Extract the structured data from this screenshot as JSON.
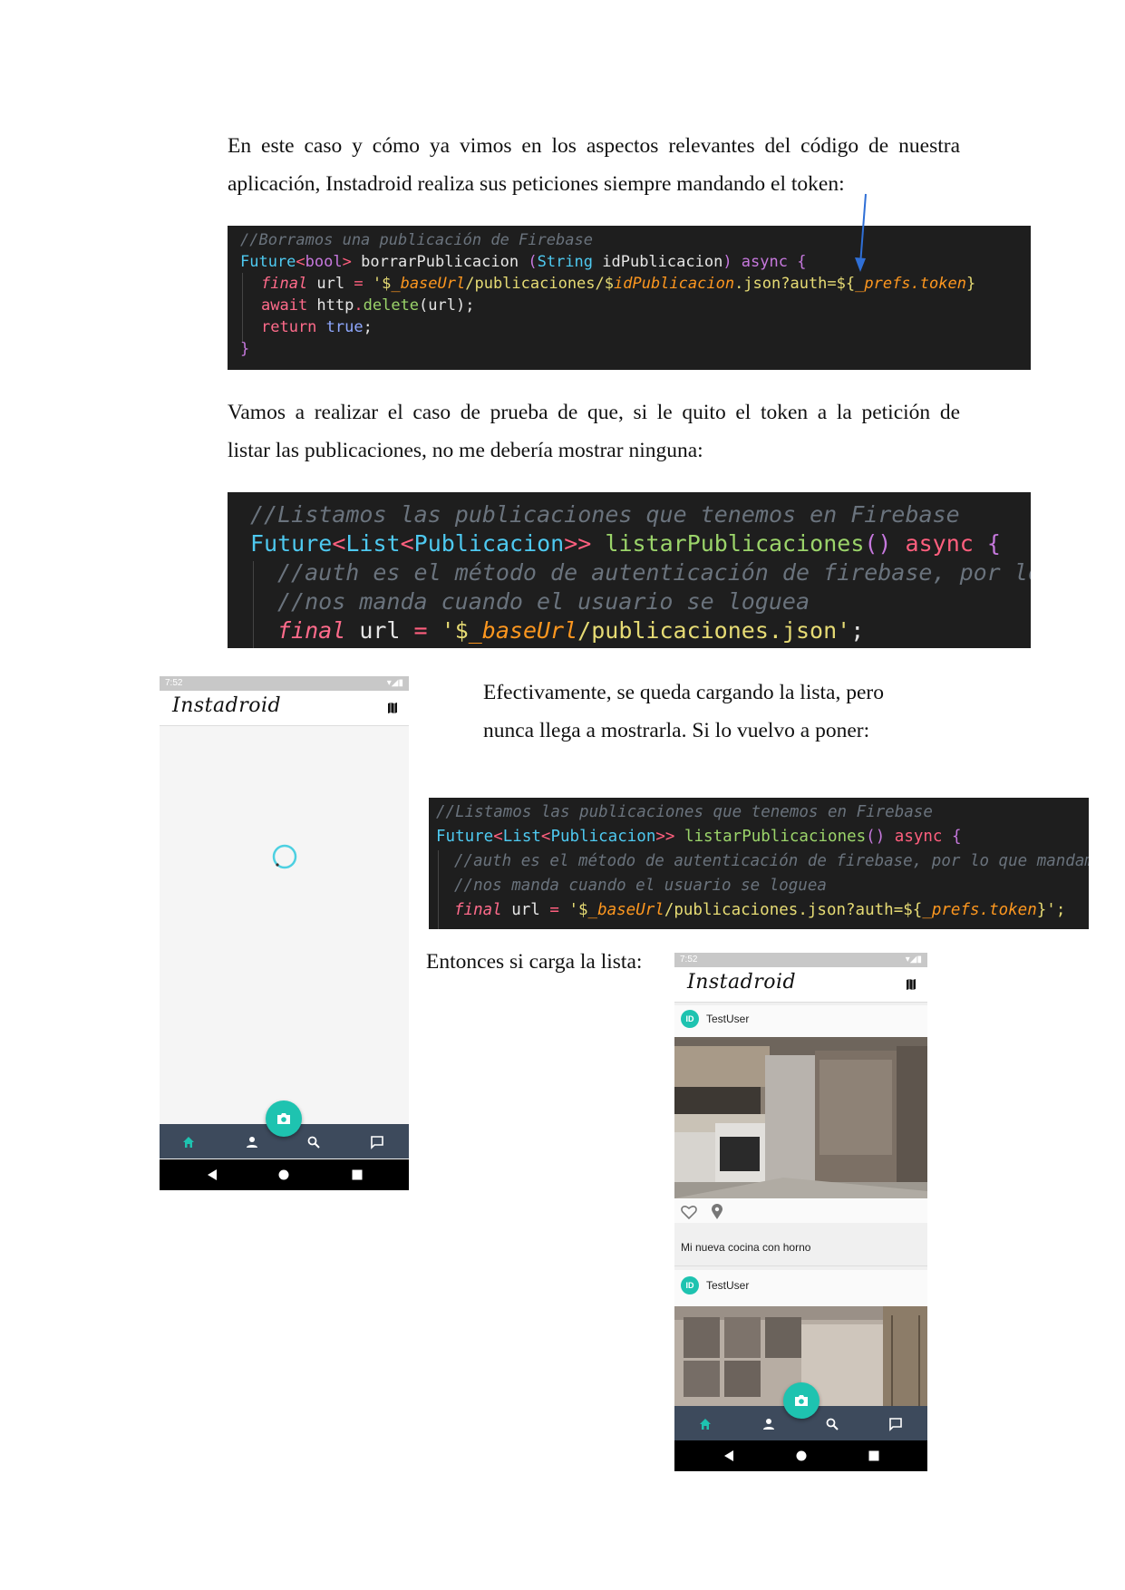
{
  "paragraph1": {
    "line1": "En este caso y cómo ya vimos en los aspectos relevantes del código de nuestra",
    "line2": "aplicación, Instadroid realiza sus peticiones siempre mandando el token:"
  },
  "code1": {
    "comment": "//Borramos una publicación de Firebase",
    "l2_type": "Future",
    "l2_lt": "<",
    "l2_bool": "bool",
    "l2_gt": ">",
    "l2_fn": " borrarPublicacion ",
    "l2_paren": "(",
    "l2_string": "String",
    "l2_param": " idPublicacion",
    "l2_close": ") ",
    "l2_async": "async",
    "l2_brace": " {",
    "l3_final": "final",
    "l3_url": " url ",
    "l3_eq": "=",
    "l3_q": " '$",
    "l3_base": "_baseUrl",
    "l3_path": "/publicaciones/$",
    "l3_id": "idPublicacion",
    "l3_json": ".json?auth=${",
    "l3_prefs": "_prefs.token",
    "l3_end": "}",
    "l4_await": "await",
    "l4_http": " http",
    "l4_dot": ".",
    "l4_delete": "delete",
    "l4_args": "(url);",
    "l5_return": "return",
    "l5_true": " true",
    "l5_semi": ";",
    "l6_brace": "}"
  },
  "paragraph2": {
    "line1": "Vamos a realizar el caso de prueba de que, si le quito el token a la petición de",
    "line2": "listar las publicaciones, no me debería mostrar ninguna:"
  },
  "code2": {
    "comment1": "//Listamos las publicaciones que tenemos en Firebase",
    "l2_future": "Future",
    "l2_lt1": "<",
    "l2_list": "List",
    "l2_lt2": "<",
    "l2_pub": "Publicacion",
    "l2_gt": ">>",
    "l2_fn": " listarPublicaciones",
    "l2_parens": "()",
    "l2_async": " async",
    "l2_brace": " {",
    "comment2": "//auth es el método de autenticación de firebase, por lo",
    "comment3": "//nos manda cuando el usuario se loguea",
    "l5_final": "final",
    "l5_url": " url ",
    "l5_eq": "=",
    "l5_q": " '$",
    "l5_base": "_baseUrl",
    "l5_path": "/publicaciones.json'",
    "l5_semi": ";"
  },
  "paragraph3": {
    "line1": "Efectivamente, se queda cargando la lista, pero",
    "line2": "nunca llega a mostrarla. Si lo vuelvo a poner:"
  },
  "code3": {
    "comment1": "//Listamos las publicaciones que tenemos en Firebase",
    "l2_future": "Future",
    "l2_lt1": "<",
    "l2_list": "List",
    "l2_lt2": "<",
    "l2_pub": "Publicacion",
    "l2_gt": ">>",
    "l2_fn": " listarPublicaciones",
    "l2_parens": "()",
    "l2_async": " async",
    "l2_brace": " {",
    "comment2": "//auth es el método de autenticación de firebase, por lo que mandamos",
    "comment3": "//nos manda cuando el usuario se loguea",
    "l5_final": "final",
    "l5_url": " url ",
    "l5_eq": "=",
    "l5_q": " '$",
    "l5_base": "_baseUrl",
    "l5_path": "/publicaciones.json?auth=${",
    "l5_prefs": "_prefs.token",
    "l5_end": "}';"
  },
  "paragraph4": {
    "text": "Entonces si carga la lista:"
  },
  "phone1": {
    "time": "7:52",
    "app_title": "Instadroid",
    "spinner_color": "#4dd0e1"
  },
  "phone2": {
    "time": "7:52",
    "app_title": "Instadroid",
    "posts": [
      {
        "avatar": "ID",
        "user": "TestUser",
        "caption": "Mi nueva cocina con horno"
      },
      {
        "avatar": "ID",
        "user": "TestUser"
      }
    ]
  },
  "colors": {
    "accent": "#1ec3b0",
    "bottom_nav": "#3d4a5c",
    "code_bg": "#1e1e1e"
  }
}
